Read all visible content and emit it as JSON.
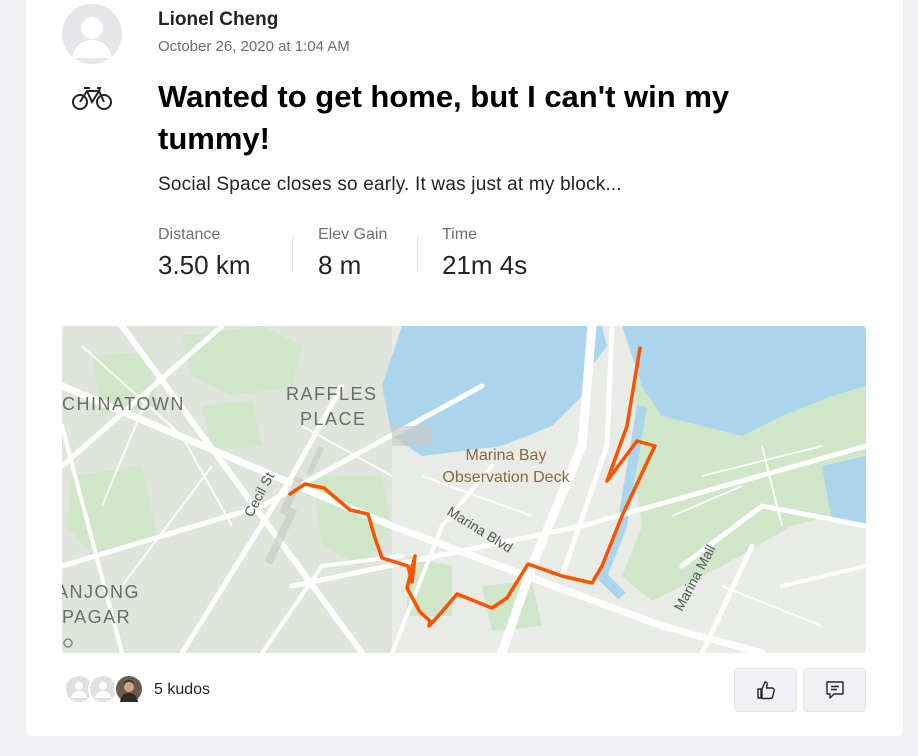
{
  "athlete": {
    "name": "Lionel Cheng"
  },
  "activity": {
    "date": "October 26, 2020 at 1:04 AM",
    "sport_icon": "bike-icon",
    "title": "Wanted to get home, but I can't win my tummy!",
    "description": "Social Space closes so early. It was just at my block...",
    "stats": [
      {
        "label": "Distance",
        "value": "3.50 km"
      },
      {
        "label": "Elev Gain",
        "value": "8 m"
      },
      {
        "label": "Time",
        "value": "21m 4s"
      }
    ]
  },
  "map": {
    "labels": {
      "chinatown": "CHINATOWN",
      "raffles_1": "RAFFLES",
      "raffles_2": "PLACE",
      "observation_1": "Marina Bay",
      "observation_2": "Observation Deck",
      "cecil": "Cecil St",
      "marina_blvd": "Marina Blvd",
      "marina_mall": "Marina Mall",
      "tanjong_1": "ANJONG",
      "tanjong_2": "PAGAR"
    },
    "route_color": "#fc5200",
    "water_color": "#abd5ec",
    "park_color": "#cfe6c9"
  },
  "kudos": {
    "count_label": "5 kudos"
  },
  "actions": {
    "kudos_icon": "thumbs-up-icon",
    "comment_icon": "comment-icon"
  }
}
